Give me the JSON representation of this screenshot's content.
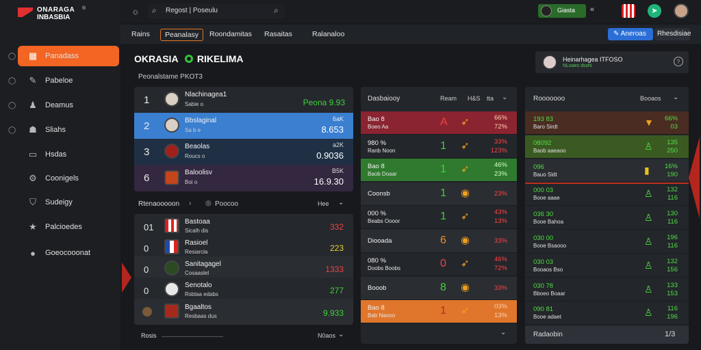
{
  "app": {
    "logo_line1": "ONARAGA",
    "logo_line2": "INBASBIA",
    "logo_mark": "®"
  },
  "topbar": {
    "search_value": "Regost | Poseulu",
    "user_badge": "Giasta",
    "chevrons": "«"
  },
  "nav": {
    "tabs": [
      "Rains",
      "Peanalasy",
      "Roondamitas",
      "Rasaitas",
      "Ralanaloo"
    ],
    "active_tab": 1,
    "action_button": "Aneroas",
    "secondary_button": "Rhesdisiae"
  },
  "sidebar": {
    "items": [
      {
        "label": "Panadass",
        "icon": "team-icon"
      },
      {
        "label": "Pabeloe",
        "icon": "pen-icon"
      },
      {
        "label": "Deamus",
        "icon": "user-icon"
      },
      {
        "label": "Sliahs",
        "icon": "ghost-icon"
      },
      {
        "label": "Hsdas",
        "icon": "note-icon"
      },
      {
        "label": "Coonigels",
        "icon": "settings-icon"
      },
      {
        "label": "Sudeigy",
        "icon": "badge-icon"
      },
      {
        "label": "Palcioedes",
        "icon": "star-icon"
      },
      {
        "label": "Goeocooonat",
        "icon": "moon-icon"
      }
    ]
  },
  "header": {
    "title_left": "OKRASIA",
    "title_right": "RIKELIMA",
    "subtitle": "Peonalstame PKOT3",
    "notification": {
      "title": "Heinarhagea ITFOSO",
      "sub": "NLoaes dsshi",
      "icon": "help-icon"
    }
  },
  "standings": {
    "rows": [
      {
        "rank": "1",
        "name": "Nlachinagea1",
        "sub": "Sabie o",
        "value": "Peona 9.93",
        "pct": "",
        "style": "plain"
      },
      {
        "rank": "2",
        "name": "Bbslaginal",
        "sub": "Sa b e",
        "value": "8.653",
        "pct": "6aK",
        "style": "blue"
      },
      {
        "rank": "3",
        "name": "Beaolas",
        "sub": "Roucs o",
        "value": "0.9036",
        "pct": "a2K",
        "style": "navy"
      },
      {
        "rank": "6",
        "name": "Baloolisv",
        "sub": "Boi o",
        "value": "16.9.30",
        "pct": "B5K",
        "style": "purple"
      }
    ]
  },
  "fixtures": {
    "header": "Rtenaooooon",
    "filter": "Poocoo",
    "sort": "Hee",
    "footer": "Rosis",
    "footer_right": "N0aos",
    "rows": [
      {
        "rank": "01",
        "name": "Bastoaa",
        "sub": "Sicalh dis",
        "value": "332",
        "color": "red"
      },
      {
        "rank": "0",
        "name": "Rasioel",
        "sub": "Resiarcla",
        "value": "223",
        "color": "orange"
      },
      {
        "rank": "0",
        "name": "Sanitagagel",
        "sub": "Cosaaslel",
        "value": "1333",
        "color": "red"
      },
      {
        "rank": "0",
        "name": "Senotalo",
        "sub": "Rsblaa edabs",
        "value": "277",
        "color": "green"
      },
      {
        "rank": "",
        "name": "Bgaaltos",
        "sub": "Resbaas dus",
        "value": "9.933",
        "color": "green"
      }
    ]
  },
  "odds": {
    "header": "Dasbaiooy",
    "col_a": "Ream",
    "col_b": "H&S",
    "col_c": "tta",
    "rows": [
      {
        "name": "Bao 8",
        "sub": "Boeo Aa",
        "num": "A",
        "pct1": "66%",
        "pct2": "72%",
        "style": "red"
      },
      {
        "name": "980 %",
        "sub": "Ranb Noon",
        "num": "1",
        "pct1": "33%",
        "pct2": "123%",
        "style": "dark"
      },
      {
        "name": "Bao 8",
        "sub": "Baob Doaar",
        "num": "1",
        "pct1": "46%",
        "pct2": "23%",
        "style": "green"
      },
      {
        "name": "Coonsb",
        "sub": "",
        "num": "1",
        "pct1": "23%",
        "pct2": "",
        "style": "dark2"
      },
      {
        "name": "000 %",
        "sub": "Beabs Oooor",
        "num": "1",
        "pct1": "43%",
        "pct2": "13%",
        "style": "dark"
      },
      {
        "name": "Diooada",
        "sub": "",
        "num": "6",
        "pct1": "33%",
        "pct2": "",
        "style": "dark2"
      },
      {
        "name": "080 %",
        "sub": "Doobs Boobs",
        "num": "0",
        "pct1": "46%",
        "pct2": "72%",
        "style": "dark"
      },
      {
        "name": "Booob",
        "sub": "",
        "num": "8",
        "pct1": "33%",
        "pct2": "",
        "style": "dark2"
      },
      {
        "name": "Bao 8",
        "sub": "Bab Naooo",
        "num": "1",
        "pct1": "03%",
        "pct2": "13%",
        "style": "orange"
      }
    ]
  },
  "market": {
    "header": "Rooooooo",
    "filter": "Booaos",
    "footer": "Radaobin",
    "footer_value": "1/3",
    "rows": [
      {
        "name": "193 83",
        "sub": "Baro Sirdt",
        "v1": "66%",
        "v2": "03",
        "style": "brown"
      },
      {
        "name": "08092",
        "sub": "Baob aaeaoo",
        "v1": "135",
        "v2": "250",
        "style": "olive"
      },
      {
        "name": "096",
        "sub": "Bauo Sldt",
        "v1": "16%",
        "v2": "190",
        "style": "dark"
      },
      {
        "name": "000 03",
        "sub": "Booe aaae",
        "v1": "132",
        "v2": "116",
        "style": "dark2"
      },
      {
        "name": "036 30",
        "sub": "Booe Bahoa",
        "v1": "130",
        "v2": "116",
        "style": "dark2"
      },
      {
        "name": "030 00",
        "sub": "Booe Bsaooo",
        "v1": "196",
        "v2": "116",
        "style": "dark2"
      },
      {
        "name": "030 03",
        "sub": "Booaos Bso",
        "v1": "132",
        "v2": "156",
        "style": "dark2"
      },
      {
        "name": "030 78",
        "sub": "Bboeo Boaar",
        "v1": "133",
        "v2": "153",
        "style": "dark2"
      },
      {
        "name": "090 81",
        "sub": "Booe adaet",
        "v1": "116",
        "v2": "196",
        "style": "dark2"
      }
    ]
  }
}
